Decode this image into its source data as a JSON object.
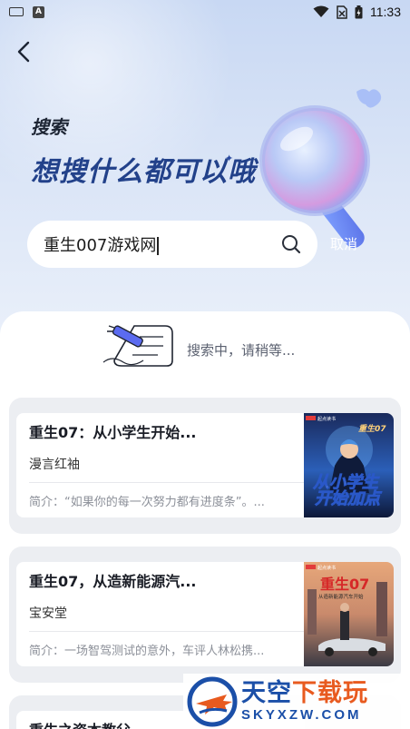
{
  "status_bar": {
    "time": "11:33"
  },
  "header": {
    "subtitle": "搜索",
    "title": "想搜什么都可以哦"
  },
  "search": {
    "value": "重生007游戏网",
    "cancel_label": "取消"
  },
  "loading": {
    "text": "搜索中，请稍等..."
  },
  "results": [
    {
      "title": "重生07：从小学生开始...",
      "author": "漫言红袖",
      "desc": "简介：“如果你的每一次努力都有进度条”。..."
    },
    {
      "title": "重生07，从造新能源汽...",
      "author": "宝安堂",
      "desc": "简介：一场智驾测试的意外，车评人林松携..."
    },
    {
      "title": "重生之资本教父",
      "author": "",
      "desc": ""
    }
  ],
  "covers": [
    {
      "badge": "起点读书",
      "title_line1": "从小学生",
      "title_line2": "开始加点",
      "top_text": "重生07"
    },
    {
      "badge": "起点读书",
      "title": "重生07",
      "subtitle": "从造新能源汽车开始"
    }
  ],
  "watermark": {
    "cn_main": "天空",
    "cn_highlight": "下载玩",
    "en": "SKYXZW.COM"
  },
  "colors": {
    "accent": "#22418a",
    "watermark_blue": "#1b4fa8",
    "watermark_orange": "#e85a1f"
  }
}
